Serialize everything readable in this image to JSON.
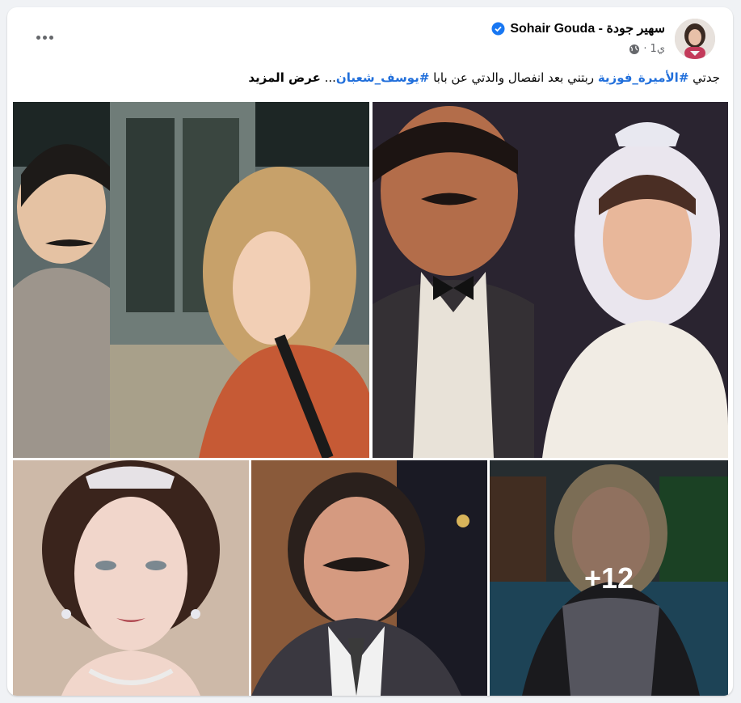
{
  "post": {
    "author": "Sohair Gouda - سهير جودة",
    "time": "1ي",
    "text_start": "جدتي ",
    "hashtag1": "#الأميرة_فوزية",
    "text_middle": " ربتني بعد انفصال والدتي عن بابا ",
    "hashtag2": "#يوسف_شعبان",
    "ellipsis": "... ",
    "see_more": "عرض المزيد"
  },
  "gallery": {
    "more_count": "+12"
  },
  "colors": {
    "hashtag": "#216fdb",
    "verified": "#1877f2",
    "meta": "#65676b"
  },
  "icons": [
    "more-options-icon",
    "verified-badge-icon",
    "globe-icon"
  ]
}
